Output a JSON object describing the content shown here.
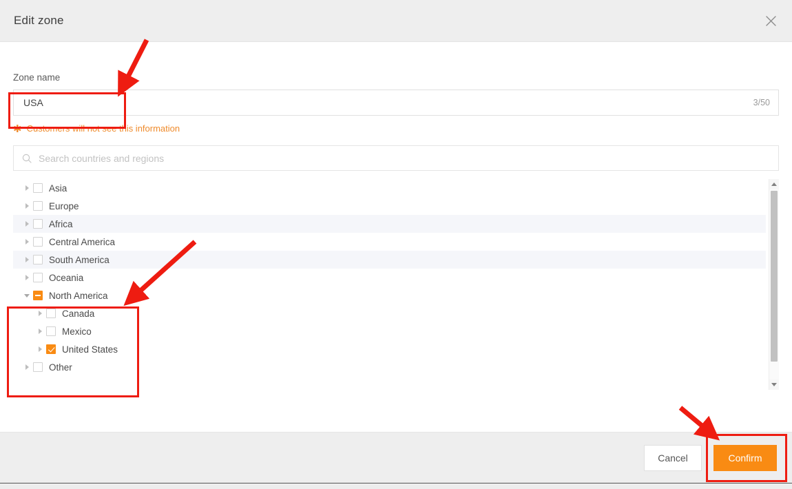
{
  "modal": {
    "title": "Edit zone",
    "close_icon": "close-icon"
  },
  "zone_name": {
    "label": "Zone name",
    "value": "USA",
    "placeholder": "",
    "counter": "3/50",
    "max_length": 50,
    "current_length": 3
  },
  "warning": {
    "star": "✱",
    "text": "Customers will not see this information"
  },
  "search": {
    "placeholder": "Search countries and regions",
    "value": "",
    "icon": "search-icon"
  },
  "tree": {
    "rows": [
      {
        "label": "Asia",
        "level": 1,
        "state": "unchecked",
        "expanded": false,
        "striped": false
      },
      {
        "label": "Europe",
        "level": 1,
        "state": "unchecked",
        "expanded": false,
        "striped": false
      },
      {
        "label": "Africa",
        "level": 1,
        "state": "unchecked",
        "expanded": false,
        "striped": true
      },
      {
        "label": "Central America",
        "level": 1,
        "state": "unchecked",
        "expanded": false,
        "striped": false
      },
      {
        "label": "South America",
        "level": 1,
        "state": "unchecked",
        "expanded": false,
        "striped": true
      },
      {
        "label": "Oceania",
        "level": 1,
        "state": "unchecked",
        "expanded": false,
        "striped": false
      },
      {
        "label": "North America",
        "level": 1,
        "state": "indeterminate",
        "expanded": true,
        "striped": false
      },
      {
        "label": "Canada",
        "level": 2,
        "state": "unchecked",
        "expanded": false,
        "striped": false
      },
      {
        "label": "Mexico",
        "level": 2,
        "state": "unchecked",
        "expanded": false,
        "striped": false
      },
      {
        "label": "United States",
        "level": 2,
        "state": "checked",
        "expanded": false,
        "striped": false
      },
      {
        "label": "Other",
        "level": 1,
        "state": "unchecked",
        "expanded": false,
        "striped": false
      }
    ]
  },
  "scrollbar": {
    "up_icon": "caret-up-icon",
    "down_icon": "caret-down-icon"
  },
  "footer": {
    "cancel_label": "Cancel",
    "confirm_label": "Confirm"
  },
  "colors": {
    "accent_orange": "#f98b13",
    "warning_orange": "#ef8b2c",
    "annotation_red": "#ee1c11",
    "header_gray": "#eeeeee",
    "row_stripe": "#f5f6fa"
  },
  "annotations": {
    "box_zone_name": "highlight around zone name input",
    "box_north_america": "highlight around North America subtree",
    "box_confirm": "highlight around Confirm button",
    "arrow_to_zone_name": "arrow pointing to zone name input",
    "arrow_to_north_america": "arrow pointing to North America group",
    "arrow_to_confirm": "arrow pointing to Confirm button"
  }
}
